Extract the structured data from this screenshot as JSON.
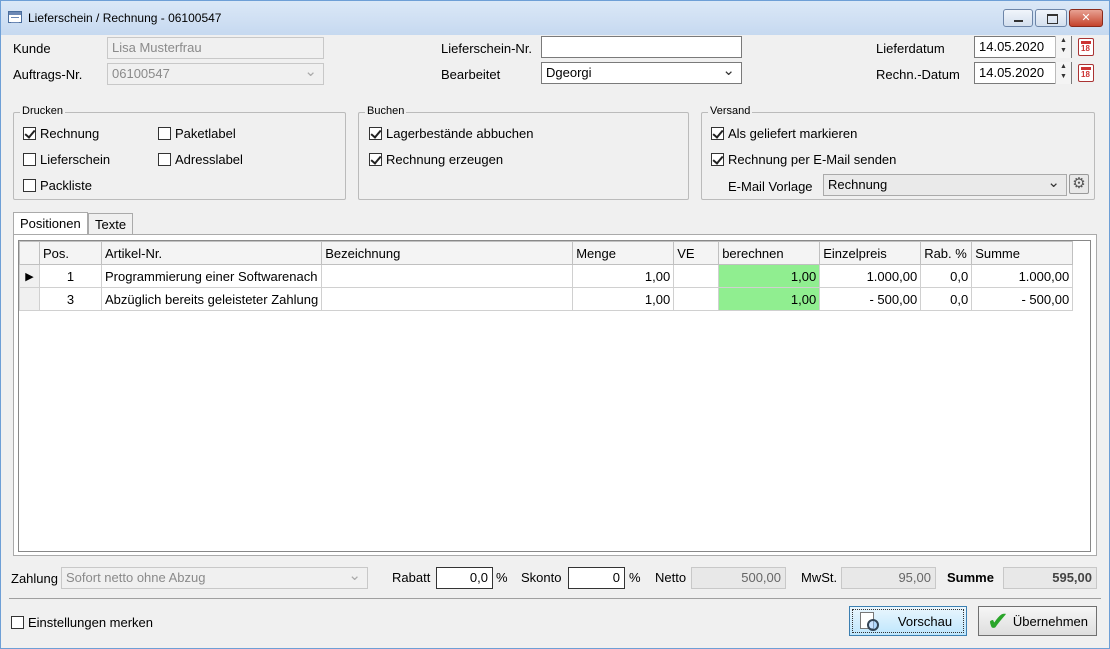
{
  "window": {
    "title": "Lieferschein / Rechnung - 06100547"
  },
  "header": {
    "kunde_label": "Kunde",
    "kunde_value": "Lisa Musterfrau",
    "auftrags_label": "Auftrags-Nr.",
    "auftrags_value": "06100547",
    "lieferschein_label": "Lieferschein-Nr.",
    "lieferschein_value": "",
    "bearbeitet_label": "Bearbeitet",
    "bearbeitet_value": "Dgeorgi",
    "lieferdatum_label": "Lieferdatum",
    "lieferdatum_value": "14.05.2020",
    "rechndatum_label": "Rechn.-Datum",
    "rechndatum_value": "14.05.2020"
  },
  "drucken": {
    "title": "Drucken",
    "items": [
      {
        "label": "Rechnung",
        "checked": true
      },
      {
        "label": "Lieferschein",
        "checked": false
      },
      {
        "label": "Packliste",
        "checked": false
      },
      {
        "label": "Paketlabel",
        "checked": false
      },
      {
        "label": "Adresslabel",
        "checked": false
      }
    ]
  },
  "buchen": {
    "title": "Buchen",
    "items": [
      {
        "label": "Lagerbestände abbuchen",
        "checked": true
      },
      {
        "label": "Rechnung erzeugen",
        "checked": true
      }
    ]
  },
  "versand": {
    "title": "Versand",
    "items": [
      {
        "label": "Als geliefert markieren",
        "checked": true
      },
      {
        "label": "Rechnung per E-Mail senden",
        "checked": true
      }
    ],
    "vorlage_label": "E-Mail Vorlage",
    "vorlage_value": "Rechnung"
  },
  "tabs": [
    {
      "label": "Positionen",
      "active": true
    },
    {
      "label": "Texte",
      "active": false
    }
  ],
  "table": {
    "columns": [
      "Pos.",
      "Artikel-Nr.",
      "Bezeichnung",
      "Menge",
      "VE",
      "berechnen",
      "Einzelpreis",
      "Rab. %",
      "Summe"
    ],
    "rows": [
      {
        "indicator": "▶",
        "pos": "1",
        "artikel": "Programmierung einer Softwarenach",
        "bezeichnung": "",
        "menge": "1,00",
        "ve": "",
        "berechnen": "1,00",
        "einzelpreis": "1.000,00",
        "rabatt": "0,0",
        "summe": "1.000,00"
      },
      {
        "indicator": "",
        "pos": "3",
        "artikel": "Abzüglich bereits geleisteter Zahlung",
        "bezeichnung": "",
        "menge": "1,00",
        "ve": "",
        "berechnen": "1,00",
        "einzelpreis": "- 500,00",
        "rabatt": "0,0",
        "summe": "- 500,00"
      }
    ]
  },
  "footer": {
    "zahlung_label": "Zahlung",
    "zahlung_value": "Sofort netto ohne Abzug",
    "rabatt_label": "Rabatt",
    "rabatt_value": "0,0",
    "rabatt_unit": "%",
    "skonto_label": "Skonto",
    "skonto_value": "0",
    "skonto_unit": "%",
    "netto_label": "Netto",
    "netto_value": "500,00",
    "mwst_label": "MwSt.",
    "mwst_value": "95,00",
    "summe_label": "Summe",
    "summe_value": "595,00"
  },
  "bottom": {
    "einstellungen_label": "Einstellungen merken",
    "einstellungen_checked": false,
    "vorschau_label": "Vorschau",
    "uebernehmen_label": "Übernehmen"
  },
  "colors": {
    "berechnen_bg": "#90ee90"
  }
}
